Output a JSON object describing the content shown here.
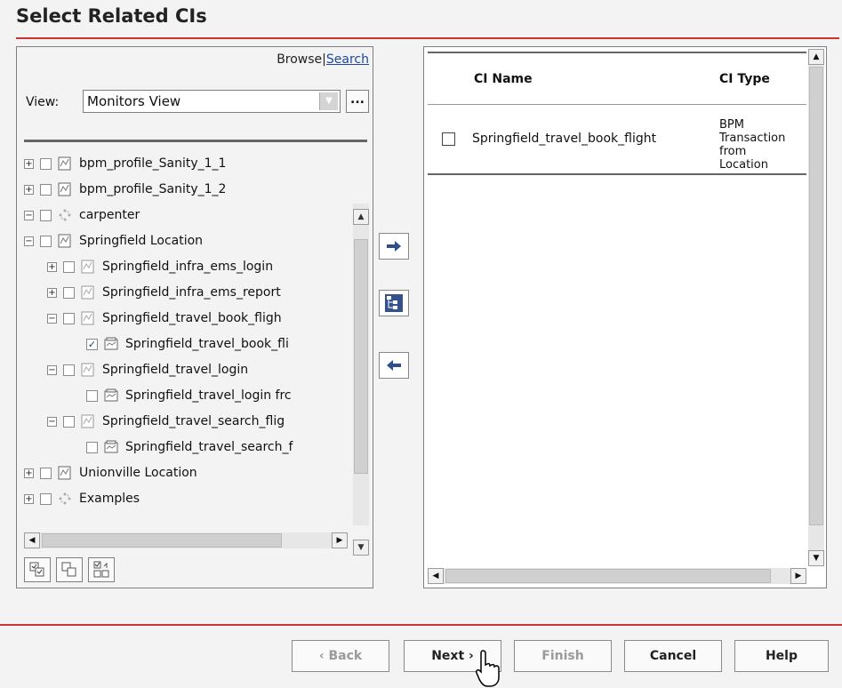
{
  "title": "Select Related CIs",
  "left_panel": {
    "browse_label": "Browse",
    "separator": "|",
    "search_label": "Search",
    "view_label": "View:",
    "view_value": "Monitors View",
    "ellipsis": "...",
    "tree": [
      {
        "label": "bpm_profile_Sanity_1_1",
        "expander": "+",
        "checked": false,
        "icon": "profile-icon"
      },
      {
        "label": "bpm_profile_Sanity_1_2",
        "expander": "+",
        "checked": false,
        "icon": "profile-icon"
      },
      {
        "label": "carpenter",
        "expander": "−",
        "checked": false,
        "icon": "group-icon"
      },
      {
        "label": "Springfield Location",
        "expander": "−",
        "checked": false,
        "icon": "profile-icon"
      },
      {
        "label": "Springfield_infra_ems_login",
        "expander": "+",
        "checked": false,
        "icon": "monitor-icon"
      },
      {
        "label": "Springfield_infra_ems_report",
        "expander": "+",
        "checked": false,
        "icon": "monitor-icon"
      },
      {
        "label": "Springfield_travel_book_fligh",
        "expander": "−",
        "checked": false,
        "icon": "monitor-icon"
      },
      {
        "label": "Springfield_travel_book_fli",
        "expander": "",
        "checked": true,
        "icon": "transaction-icon"
      },
      {
        "label": "Springfield_travel_login",
        "expander": "−",
        "checked": false,
        "icon": "monitor-icon"
      },
      {
        "label": "Springfield_travel_login frc",
        "expander": "",
        "checked": false,
        "icon": "transaction-icon"
      },
      {
        "label": "Springfield_travel_search_flig",
        "expander": "−",
        "checked": false,
        "icon": "monitor-icon"
      },
      {
        "label": "Springfield_travel_search_f",
        "expander": "",
        "checked": false,
        "icon": "transaction-icon"
      },
      {
        "label": "Unionville Location",
        "expander": "+",
        "checked": false,
        "icon": "profile-icon"
      },
      {
        "label": "Examples",
        "expander": "+",
        "checked": false,
        "icon": "group-icon"
      }
    ]
  },
  "right_panel": {
    "columns": [
      "CI Name",
      "CI Type"
    ],
    "rows": [
      {
        "name": "Springfield_travel_book_flight",
        "type": "BPM Transaction from Location",
        "checked": false
      }
    ]
  },
  "footer": {
    "back": "‹ Back",
    "next": "Next ›",
    "finish": "Finish",
    "cancel": "Cancel",
    "help": "Help"
  },
  "colors": {
    "accent_rule": "#cc3333",
    "link": "#1a49a3"
  }
}
